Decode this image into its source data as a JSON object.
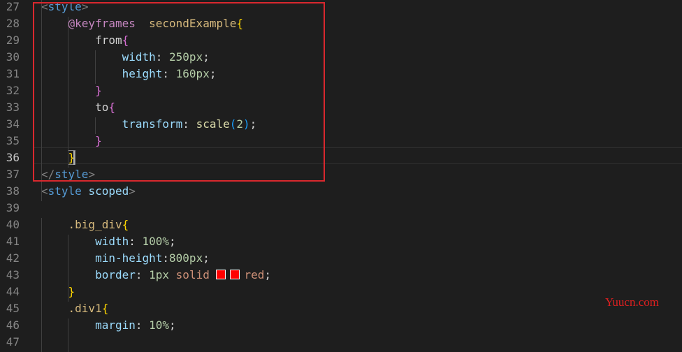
{
  "editor": {
    "lines": [
      {
        "n": "27",
        "tokens": [
          [
            "<",
            "tag-p"
          ],
          [
            "style",
            "tag"
          ],
          [
            ">",
            "tag-p"
          ]
        ]
      },
      {
        "n": "28",
        "tokens": [
          [
            "    ",
            ""
          ],
          [
            "@keyframes",
            "kw"
          ],
          [
            "  ",
            ""
          ],
          [
            "secondExample",
            "sel"
          ],
          [
            "{",
            "b1"
          ]
        ]
      },
      {
        "n": "29",
        "tokens": [
          [
            "        ",
            ""
          ],
          [
            "from",
            "punct"
          ],
          [
            "{",
            "b2"
          ]
        ]
      },
      {
        "n": "30",
        "tokens": [
          [
            "            ",
            ""
          ],
          [
            "width",
            "prop"
          ],
          [
            ": ",
            "punct"
          ],
          [
            "250px",
            "num"
          ],
          [
            ";",
            "punct"
          ]
        ]
      },
      {
        "n": "31",
        "tokens": [
          [
            "            ",
            ""
          ],
          [
            "height",
            "prop"
          ],
          [
            ": ",
            "punct"
          ],
          [
            "160px",
            "num"
          ],
          [
            ";",
            "punct"
          ]
        ]
      },
      {
        "n": "32",
        "tokens": [
          [
            "        ",
            ""
          ],
          [
            "}",
            "b2"
          ]
        ]
      },
      {
        "n": "33",
        "tokens": [
          [
            "        ",
            ""
          ],
          [
            "to",
            "punct"
          ],
          [
            "{",
            "b2"
          ]
        ]
      },
      {
        "n": "34",
        "tokens": [
          [
            "            ",
            ""
          ],
          [
            "transform",
            "prop"
          ],
          [
            ": ",
            "punct"
          ],
          [
            "scale",
            "fn"
          ],
          [
            "(",
            "b3"
          ],
          [
            "2",
            "num"
          ],
          [
            ")",
            "b3"
          ],
          [
            ";",
            "punct"
          ]
        ]
      },
      {
        "n": "35",
        "tokens": [
          [
            "        ",
            ""
          ],
          [
            "}",
            "b2"
          ]
        ]
      },
      {
        "n": "36",
        "active": true,
        "tokens": [
          [
            "    ",
            ""
          ],
          [
            "}",
            "b1 bracket-match"
          ]
        ]
      },
      {
        "n": "37",
        "tokens": [
          [
            "</",
            "tag-p"
          ],
          [
            "style",
            "tag"
          ],
          [
            ">",
            "tag-p"
          ]
        ]
      },
      {
        "n": "38",
        "tokens": [
          [
            "<",
            "tag-p"
          ],
          [
            "style",
            "tag"
          ],
          [
            " ",
            ""
          ],
          [
            "scoped",
            "attr"
          ],
          [
            ">",
            "tag-p"
          ]
        ]
      },
      {
        "n": "39",
        "tokens": []
      },
      {
        "n": "40",
        "tokens": [
          [
            "    ",
            ""
          ],
          [
            ".big_div",
            "sel"
          ],
          [
            "{",
            "b1"
          ]
        ]
      },
      {
        "n": "41",
        "tokens": [
          [
            "        ",
            ""
          ],
          [
            "width",
            "prop"
          ],
          [
            ": ",
            "punct"
          ],
          [
            "100%",
            "num"
          ],
          [
            ";",
            "punct"
          ]
        ]
      },
      {
        "n": "42",
        "tokens": [
          [
            "        ",
            ""
          ],
          [
            "min-height",
            "prop"
          ],
          [
            ":",
            "punct"
          ],
          [
            "800px",
            "num"
          ],
          [
            ";",
            "punct"
          ]
        ]
      },
      {
        "n": "43",
        "tokens": [
          [
            "        ",
            ""
          ],
          [
            "border",
            "prop"
          ],
          [
            ": ",
            "punct"
          ],
          [
            "1px",
            "num"
          ],
          [
            " ",
            ""
          ],
          [
            "solid",
            "val"
          ],
          [
            " ",
            ""
          ],
          [
            "",
            "swatch"
          ],
          [
            "",
            "swatch"
          ],
          [
            "red",
            "val"
          ],
          [
            ";",
            "punct"
          ]
        ]
      },
      {
        "n": "44",
        "tokens": [
          [
            "    ",
            ""
          ],
          [
            "}",
            "b1"
          ]
        ]
      },
      {
        "n": "45",
        "tokens": [
          [
            "    ",
            ""
          ],
          [
            ".div1",
            "sel"
          ],
          [
            "{",
            "b1"
          ]
        ]
      },
      {
        "n": "46",
        "tokens": [
          [
            "        ",
            ""
          ],
          [
            "margin",
            "prop"
          ],
          [
            ": ",
            "punct"
          ],
          [
            "10%",
            "num"
          ],
          [
            ";",
            "punct"
          ]
        ]
      },
      {
        "n": "47",
        "tokens": []
      }
    ]
  },
  "watermark": {
    "text": "Yuucn.com"
  }
}
